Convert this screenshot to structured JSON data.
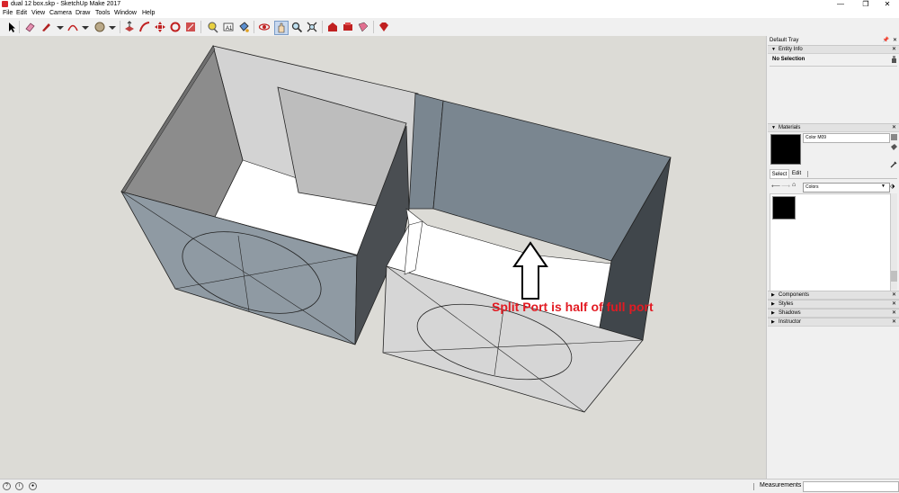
{
  "window": {
    "title": "dual 12 box.skp - SketchUp Make 2017",
    "minimize": "—",
    "maximize": "❐",
    "close": "✕"
  },
  "menu": [
    "File",
    "Edit",
    "View",
    "Camera",
    "Draw",
    "Tools",
    "Window",
    "Help"
  ],
  "toolbar": {
    "tools": [
      "select-icon",
      "eraser-icon",
      "pencil-icon",
      "arc-icon",
      "shape-icon",
      "push-pull-icon",
      "follow-me-icon",
      "move-icon",
      "rotate-icon",
      "scale-icon",
      "tape-measure-icon",
      "text-icon",
      "paint-bucket-icon",
      "orbit-icon",
      "pan-icon",
      "zoom-icon",
      "zoom-extents-icon",
      "warehouse-icon",
      "extension-icon",
      "share-icon",
      "ruby-icon"
    ]
  },
  "annotation": {
    "text": "Split Port is half of full port"
  },
  "tray": {
    "title": "Default Tray",
    "entity_info": {
      "header": "Entity Info",
      "selection": "No Selection"
    },
    "materials": {
      "header": "Materials",
      "material_name": "Color M09",
      "tab_select": "Select",
      "tab_edit": "Edit",
      "library": "Colors",
      "swatch_color": "#000000"
    },
    "panels": [
      "Components",
      "Styles",
      "Shadows",
      "Instructor"
    ]
  },
  "status": {
    "measurements_label": "Measurements",
    "measurements_value": ""
  }
}
